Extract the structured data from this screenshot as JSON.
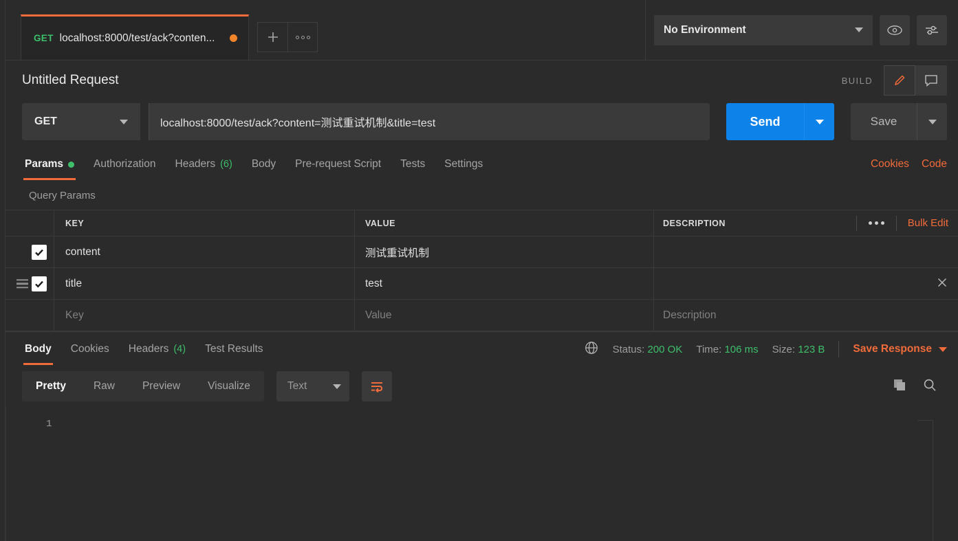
{
  "tabbar": {
    "request_tab": {
      "method": "GET",
      "title": "localhost:8000/test/ack?conten...",
      "unsaved": true
    },
    "new_tab_label": "+",
    "more_tabs_label": "•••",
    "environment": {
      "selected": "No Environment"
    },
    "eye_icon": "eye-icon",
    "settings_icon": "sliders-icon"
  },
  "request_header": {
    "name": "Untitled Request",
    "build_label": "BUILD",
    "edit_icon": "pencil-icon",
    "comment_icon": "comment-icon"
  },
  "url_bar": {
    "method": "GET",
    "url": "localhost:8000/test/ack?content=测试重试机制&title=test",
    "send_label": "Send",
    "save_label": "Save"
  },
  "request_tabs": {
    "items": [
      {
        "label": "Params",
        "active": true,
        "dot": true
      },
      {
        "label": "Authorization",
        "active": false
      },
      {
        "label": "Headers",
        "active": false,
        "count": "(6)"
      },
      {
        "label": "Body",
        "active": false
      },
      {
        "label": "Pre-request Script",
        "active": false
      },
      {
        "label": "Tests",
        "active": false
      },
      {
        "label": "Settings",
        "active": false
      }
    ],
    "links": [
      {
        "label": "Cookies"
      },
      {
        "label": "Code"
      }
    ]
  },
  "query_params": {
    "section_title": "Query Params",
    "columns": [
      "KEY",
      "VALUE",
      "DESCRIPTION"
    ],
    "bulk_edit_label": "Bulk Edit",
    "rows": [
      {
        "checked": true,
        "key": "content",
        "value": "测试重试机制",
        "description": ""
      },
      {
        "checked": true,
        "key": "title",
        "value": "test",
        "description": ""
      }
    ],
    "placeholder_row": {
      "key": "Key",
      "value": "Value",
      "description": "Description"
    }
  },
  "response": {
    "tabs": [
      {
        "label": "Body",
        "active": true
      },
      {
        "label": "Cookies",
        "active": false
      },
      {
        "label": "Headers",
        "active": false,
        "count": "(4)"
      },
      {
        "label": "Test Results",
        "active": false
      }
    ],
    "status_label": "Status:",
    "status_value": "200 OK",
    "time_label": "Time:",
    "time_value": "106 ms",
    "size_label": "Size:",
    "size_value": "123 B",
    "save_response_label": "Save Response",
    "view_modes": [
      {
        "label": "Pretty",
        "active": true
      },
      {
        "label": "Raw",
        "active": false
      },
      {
        "label": "Preview",
        "active": false
      },
      {
        "label": "Visualize",
        "active": false
      }
    ],
    "format": "Text",
    "wrap_icon": "word-wrap-icon",
    "copy_icon": "copy-icon",
    "search_icon": "search-icon",
    "globe_icon": "globe-icon",
    "body_line_number": "1",
    "body_text": ""
  },
  "colors": {
    "accent_orange": "#f26b3a",
    "send_blue": "#0d82e8",
    "success_green": "#3dbf6b",
    "bg": "#2b2b2b",
    "panel": "#3a3a3a"
  }
}
